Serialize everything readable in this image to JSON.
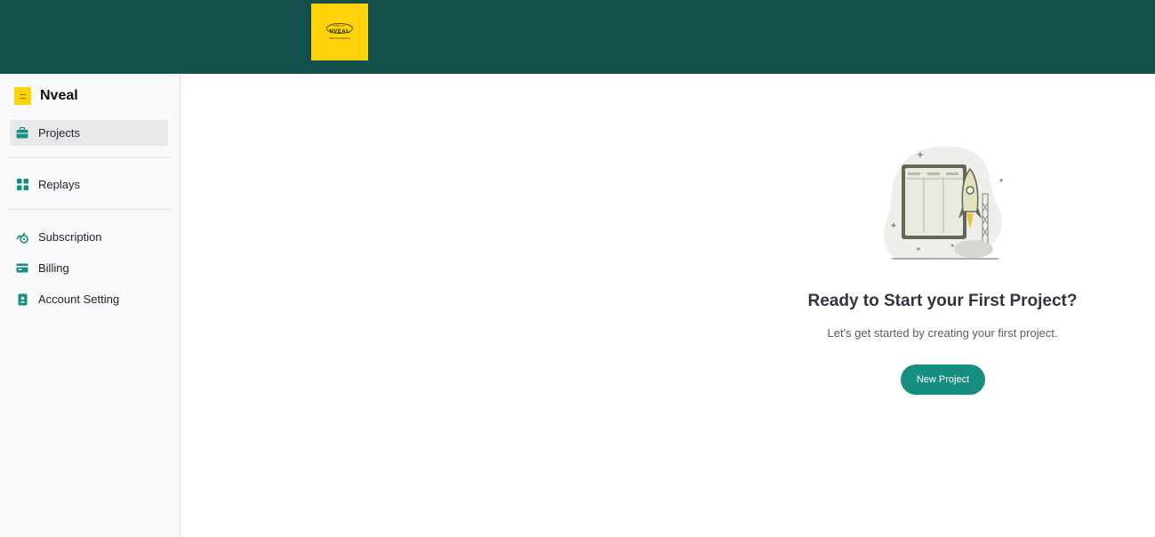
{
  "header": {
    "logo": {
      "top_text": "REPLAY",
      "word": "NVEAL",
      "tagline": "SESSION REPLAYS"
    }
  },
  "sidebar": {
    "brand": {
      "name": "Nveal",
      "icon": "nveal-logo-icon"
    },
    "items": [
      {
        "label": "Projects",
        "icon": "briefcase-icon",
        "active": true
      },
      {
        "label": "Replays",
        "icon": "grid-icon",
        "active": false
      },
      {
        "label": "Subscription",
        "icon": "subscription-icon",
        "active": false
      },
      {
        "label": "Billing",
        "icon": "credit-card-icon",
        "active": false
      },
      {
        "label": "Account Setting",
        "icon": "contact-card-icon",
        "active": false
      }
    ]
  },
  "main": {
    "illustration": "rocket-dashboard-illustration",
    "heading": "Ready to Start your First Project?",
    "subtext": "Let's get started by creating your first project.",
    "button_label": "New Project"
  },
  "colors": {
    "topbar": "#134f4b",
    "accent": "#178f80",
    "brand_yellow": "#ffd20a",
    "sidebar_bg": "#f7f9fb"
  }
}
